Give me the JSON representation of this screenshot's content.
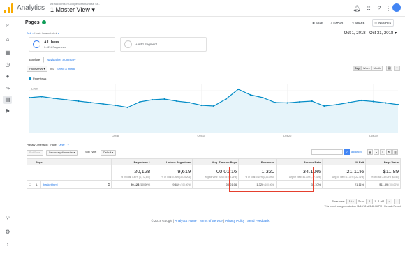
{
  "topbar": {
    "app_name": "Analytics",
    "account_crumb": "All accounts > Google Merchandise St...",
    "view_name": "1 Master View",
    "icons": [
      "bell-icon",
      "apps-icon",
      "help-icon",
      "more-icon"
    ]
  },
  "report": {
    "title": "Pages",
    "actions": {
      "save": "SAVE",
      "export": "EXPORT",
      "share": "SHARE",
      "insights": "INSIGHTS"
    },
    "breadcrumb_all": "ALL",
    "breadcrumb_path": "Host: /basket.html",
    "date_range": "Oct 1, 2018 - Oct 31, 2018"
  },
  "segments": {
    "primary_name": "All Users",
    "primary_sub": "0.42% Pageviews",
    "add_label": "+ Add Segment"
  },
  "tabs": [
    {
      "label": "Explorer",
      "active": true
    },
    {
      "label": "Navigation Summary",
      "active": false
    }
  ],
  "metric_controls": {
    "metric": "Pageviews",
    "vs": "VS.",
    "select_metric": "Select a metric",
    "periods": [
      "Day",
      "Week",
      "Month"
    ],
    "active_period": "Day"
  },
  "chart_data": {
    "type": "line",
    "series": [
      {
        "name": "Pageviews",
        "color": "#058dc7",
        "values": [
          1000,
          1030,
          980,
          940,
          900,
          860,
          820,
          780,
          720,
          880,
          940,
          960,
          900,
          860,
          780,
          760,
          960,
          1240,
          1080,
          1000,
          860,
          850,
          880,
          900,
          760,
          800,
          860,
          920,
          890,
          850,
          800
        ]
      }
    ],
    "x_tick_labels": [
      "Oct 8",
      "Oct 15",
      "Oct 22",
      "Oct 29"
    ],
    "x_tick_index": [
      7,
      14,
      21,
      28
    ],
    "y_tick_labels": [
      "1,200",
      "600"
    ],
    "y_tick_values": [
      1200,
      600
    ],
    "ylim": [
      0,
      1400
    ],
    "grid": true
  },
  "dimension": {
    "label": "Primary Dimension:",
    "page": "Page",
    "other": "Other"
  },
  "table_controls": {
    "plot_rows": "Plot Rows",
    "secondary": "Secondary dimension",
    "sort_label": "Sort Type:",
    "sort_value": "Default",
    "advanced": "advanced"
  },
  "columns": [
    "Page",
    "Pageviews",
    "Unique Pageviews",
    "Avg. Time on Page",
    "Entrances",
    "Bounce Rate",
    "% Exit",
    "Page Value"
  ],
  "totals": {
    "pageviews": "20,128",
    "pageviews_sub": "% of Total: 0.42% (4,772,878)",
    "unique": "9,619",
    "unique_sub": "% of Total: 0.26% (3,725,206)",
    "avg_time": "00:01:16",
    "avg_time_sub": "Avg for View: 00:00:45 (65.25%)",
    "entrances": "1,320",
    "entrances_sub": "% of Total: 0.10% (1,301,992)",
    "bounce": "34.10%",
    "bounce_sub": "Avg for View: 41.33% (-17.51%)",
    "exit": "21.11%",
    "exit_sub": "Avg for View: 27.31% (-22.71%)",
    "value": "$11.89",
    "value_sub": "% of Total: 239.09% ($3.50)"
  },
  "rows": [
    {
      "index": "1.",
      "page": "/basket.html",
      "pageviews": "20,128",
      "pageviews_pct": "(100.00%)",
      "unique": "9,619",
      "unique_pct": "(100.00%)",
      "avg_time": "00:01:16",
      "entrances": "1,320",
      "entrances_pct": "(100.00%)",
      "bounce": "34.10%",
      "exit": "21.11%",
      "value": "$11.89",
      "value_pct": "(100.00%)"
    }
  ],
  "pager": {
    "show_rows": "Show rows:",
    "rows_value": "10",
    "goto_label": "Go to:",
    "goto_value": "1",
    "range": "1 - 1 of 1"
  },
  "report_note": "This report was generated on 11/12/18 at 3:42:06 PM · Refresh Report",
  "footer": {
    "copyright": "© 2018 Google",
    "links": [
      "Analytics Home",
      "Terms of Service",
      "Privacy Policy",
      "Send Feedback"
    ]
  }
}
